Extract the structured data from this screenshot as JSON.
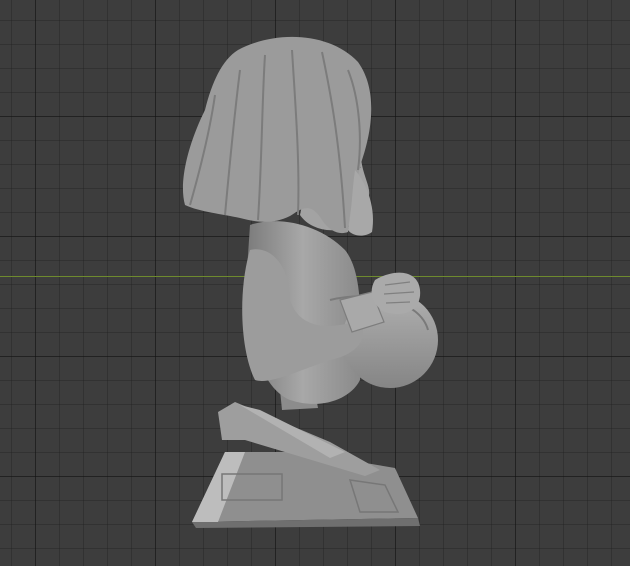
{
  "viewport": {
    "background_color": "#3d3d3d",
    "grid_color": "#2a2a2a",
    "axis_color": "#6e8a2e",
    "model_color": "#9a9a9a",
    "object": "sculpted-bust-model"
  }
}
